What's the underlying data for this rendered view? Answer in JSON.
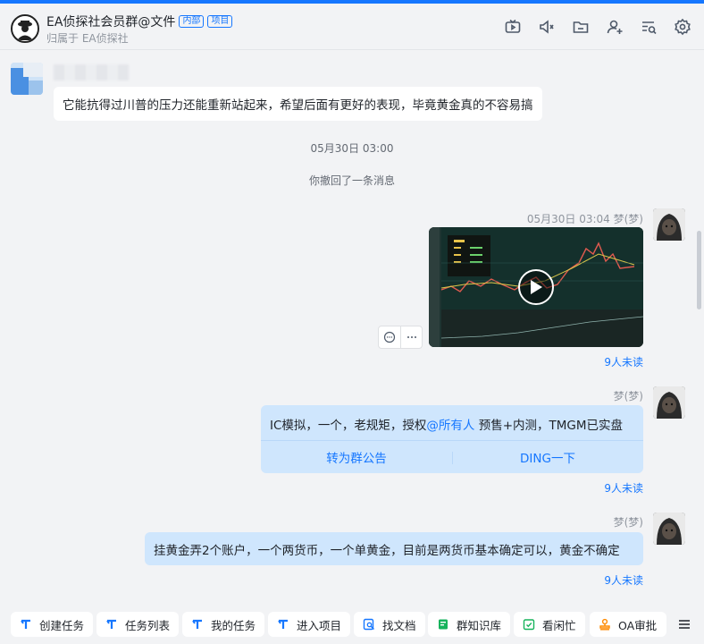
{
  "header": {
    "title": "EA侦探社会员群@文件",
    "tags": [
      "内部",
      "项目"
    ],
    "subtitle": "归属于 EA侦探社",
    "icons": [
      "tv-icon",
      "speaker-icon",
      "folder-icon",
      "add-user-icon",
      "search-list-icon",
      "gear-icon"
    ]
  },
  "messages": {
    "first_text": "它能抗得过川普的压力还能重新站起来，希望后面有更好的表现，毕竟黄金真的不容易搞",
    "time_divider": "05月30日 03:00",
    "recall_notice": "你撤回了一条消息",
    "video_meta": "05月30日 03:04 梦(梦)",
    "video_unread": "9人未读",
    "ding_sender": "梦(梦)",
    "ding_text_prefix": "IC模拟，一个，老规矩，授权",
    "ding_mention": "@所有人",
    "ding_text_suffix": " 预售+内测，TMGM已实盘",
    "ding_btn_left": "转为群公告",
    "ding_btn_right": "DING一下",
    "ding_unread": "9人未读",
    "last_sender": "梦(梦)",
    "last_text": "挂黄金弄2个账户，一个两货币，一个单黄金，目前是两货币基本确定可以，黄金不确定",
    "last_unread": "9人未读"
  },
  "bottom_bar": {
    "items": [
      "创建任务",
      "任务列表",
      "我的任务",
      "进入项目",
      "找文档",
      "群知识库",
      "看闲忙",
      "OA审批"
    ]
  },
  "colors": {
    "accent": "#1677ff",
    "bubble_self": "#cfe6fd",
    "background": "#f2f3f5"
  }
}
